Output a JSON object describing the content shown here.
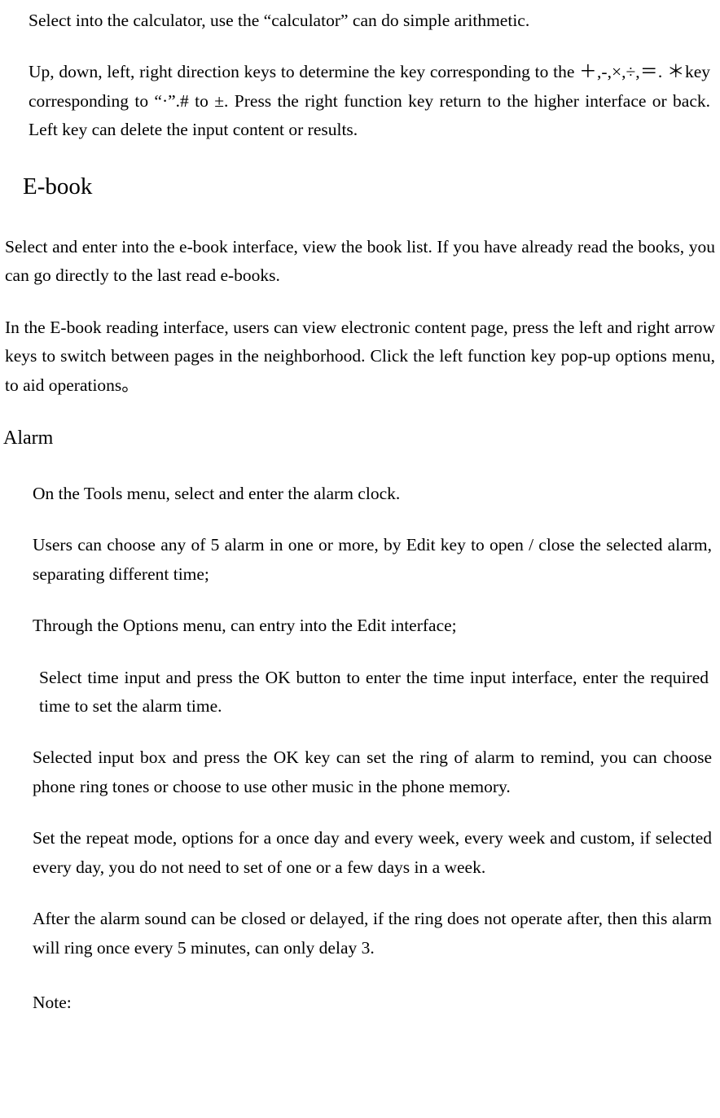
{
  "calculator": {
    "p1": "Select into the calculator, use the “calculator” can do simple arithmetic.",
    "p2": "Up, down, left, right direction keys to determine the key corresponding to the ＋,-,×,÷,＝. ＊key corresponding to “·”.# to ±. Press the right function key return to the higher interface or back. Left key can delete the input content or results."
  },
  "ebook": {
    "heading": "E-book",
    "p1": "Select and enter into the e-book interface, view the book list. If you have already read the books, you can go directly to the last read e-books.",
    "p2": "In the E-book reading interface, users can view electronic content page, press the left and right arrow keys to switch between pages in the neighborhood. Click the left function key pop-up options menu, to aid operations。"
  },
  "alarm": {
    "heading": "Alarm",
    "p1": "On the Tools menu, select and enter the alarm clock.",
    "p2": "Users can choose any of 5 alarm in one or more, by Edit key to open / close the selected alarm, separating different time;",
    "p3": "Through the Options menu, can entry into the Edit interface;",
    "p4": "Select time input and press the OK button to enter the time input interface, enter the required time to set the alarm time.",
    "p5": "Selected input box and press the OK key can set the ring of alarm to remind, you can choose phone ring tones or choose to use other music in the phone memory.",
    "p6": "Set the repeat mode, options for a once day and every week, every week and custom, if selected every day, you do not need to  set of one or a few days in a week.",
    "p7": "After the alarm sound can be closed or delayed, if the ring does not operate after, then this alarm will ring once every 5 minutes, can only delay 3.",
    "note": "Note:"
  }
}
